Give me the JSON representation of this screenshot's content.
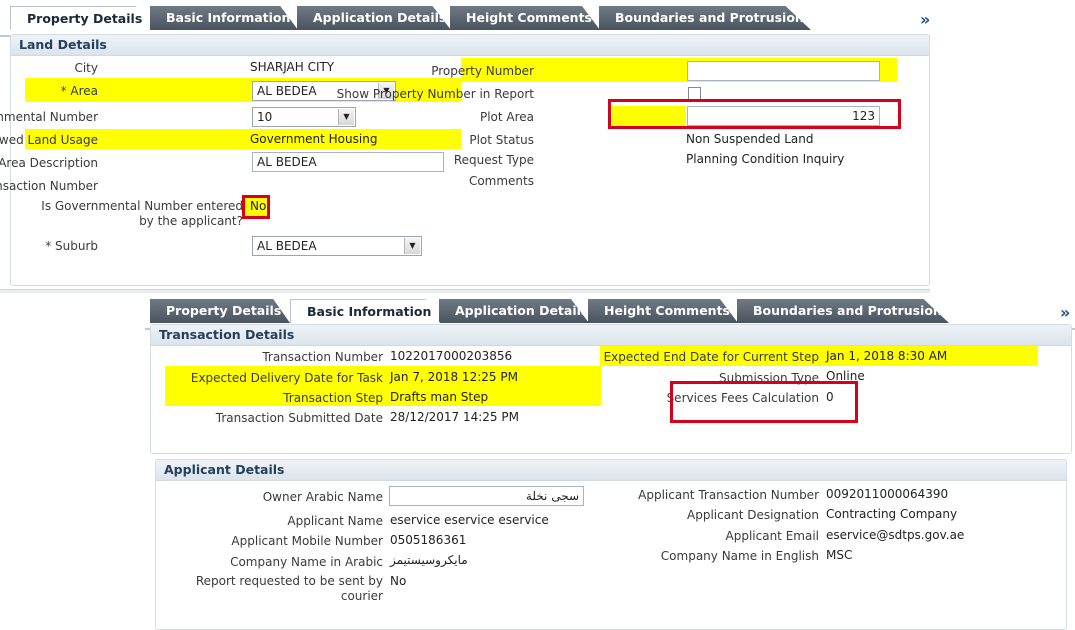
{
  "panel1": {
    "tabs": [
      "Property Details",
      "Basic Information",
      "Application Details",
      "Height Comments",
      "Boundaries and Protrusion"
    ],
    "more_icon": "»",
    "section_title": "Land Details",
    "fields": {
      "city_label": "City",
      "city_value": "SHARJAH CITY",
      "area_label": "* Area",
      "area_value": "AL BEDEA",
      "gov_number_label": "* Governmental Number",
      "gov_number_value": "10",
      "land_usage_label": "Allowed Land Usage",
      "land_usage_value": "Government Housing",
      "area_desc_label": "* Area Description",
      "area_desc_value": "AL BEDEA",
      "old_txn_label": "Old Transaction Number",
      "gov_entered_label": "Is Governmental Number entered by the applicant?",
      "gov_entered_value": "No",
      "suburb_label": "* Suburb",
      "suburb_value": "AL BEDEA",
      "property_number_label": "Property Number",
      "property_number_value": "",
      "show_property_label": "Show Property Number in Report",
      "plot_area_label": "Plot Area",
      "plot_area_value": "123",
      "plot_status_label": "Plot Status",
      "plot_status_value": "Non Suspended Land",
      "request_type_label": "Request Type",
      "request_type_value": "Planning Condition Inquiry",
      "comments_label": "Comments"
    }
  },
  "panel2": {
    "tabs": [
      "Property Details",
      "Basic Information",
      "Application Details",
      "Height Comments",
      "Boundaries and Protrusion"
    ],
    "more_icon": "»",
    "transaction": {
      "section_title": "Transaction Details",
      "txn_number_label": "Transaction Number",
      "txn_number_value": "1022017000203856",
      "delivery_label": "Expected Delivery Date for Task",
      "delivery_value": "Jan 7, 2018 12:25 PM",
      "step_label": "Transaction Step",
      "step_value": "Drafts man Step",
      "submitted_label": "Transaction Submitted Date",
      "submitted_value": "28/12/2017 14:25 PM",
      "end_date_label": "Expected End Date for Current Step",
      "end_date_value": "Jan 1, 2018 8:30 AM",
      "submission_type_label": "Submission Type",
      "submission_type_value": "Online",
      "fees_label": "Services Fees Calculation",
      "fees_value": "0"
    },
    "applicant": {
      "section_title": "Applicant Details",
      "owner_arabic_label": "Owner Arabic Name",
      "owner_arabic_value": "سجى نخلة",
      "applicant_name_label": "Applicant Name",
      "applicant_name_value": "eservice eservice eservice",
      "mobile_label": "Applicant Mobile Number",
      "mobile_value": "0505186361",
      "company_arabic_label": "Company Name in Arabic",
      "company_arabic_value": "مايكروسيستيمز",
      "courier_label": "Report requested to be sent by courier",
      "courier_value": "No",
      "app_txn_label": "Applicant Transaction Number",
      "app_txn_value": "0092011000064390",
      "designation_label": "Applicant Designation",
      "designation_value": "Contracting Company",
      "email_label": "Applicant Email",
      "email_value": "eservice@sdtps.gov.ae",
      "company_english_label": "Company Name in English",
      "company_english_value": "MSC"
    }
  },
  "colors": {
    "highlight": "#ffff00",
    "annotation_red": "#d6001c",
    "tab_dark": "#4a545e",
    "heading": "#24405e"
  }
}
